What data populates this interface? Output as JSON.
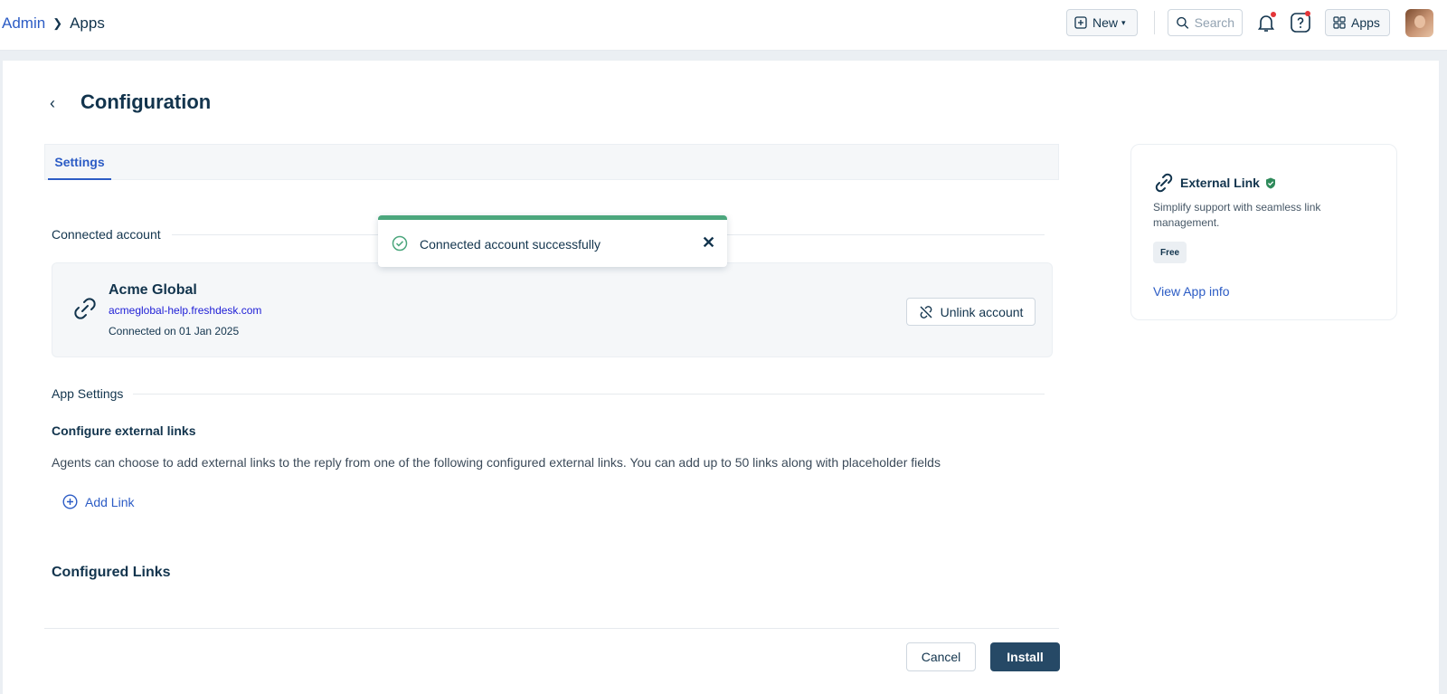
{
  "breadcrumb": {
    "parent": "Admin",
    "current": "Apps"
  },
  "topbar": {
    "new_label": "New",
    "search_placeholder": "Search",
    "apps_label": "Apps"
  },
  "page": {
    "title": "Configuration",
    "tab": "Settings"
  },
  "connected": {
    "heading": "Connected account",
    "name": "Acme Global",
    "url": "acmeglobal-help.freshdesk.com",
    "date": "Connected on 01 Jan 2025",
    "unlink_label": "Unlink account"
  },
  "toast": {
    "message": "Connected account successfully"
  },
  "app_settings": {
    "heading": "App Settings",
    "subheading": "Configure external links",
    "description": "Agents can choose to add external links to the reply from one of the following configured external links. You can add up to 50 links along with placeholder fields",
    "add_link": "Add Link",
    "configured_heading": "Configured Links"
  },
  "footer": {
    "cancel": "Cancel",
    "install": "Install"
  },
  "app_card": {
    "name": "External Link",
    "description": "Simplify support with seamless link management.",
    "badge": "Free",
    "info_link": "View App info"
  },
  "colors": {
    "accent": "#2c5cc5",
    "success": "#4ba67c",
    "primary_button": "#264966"
  }
}
